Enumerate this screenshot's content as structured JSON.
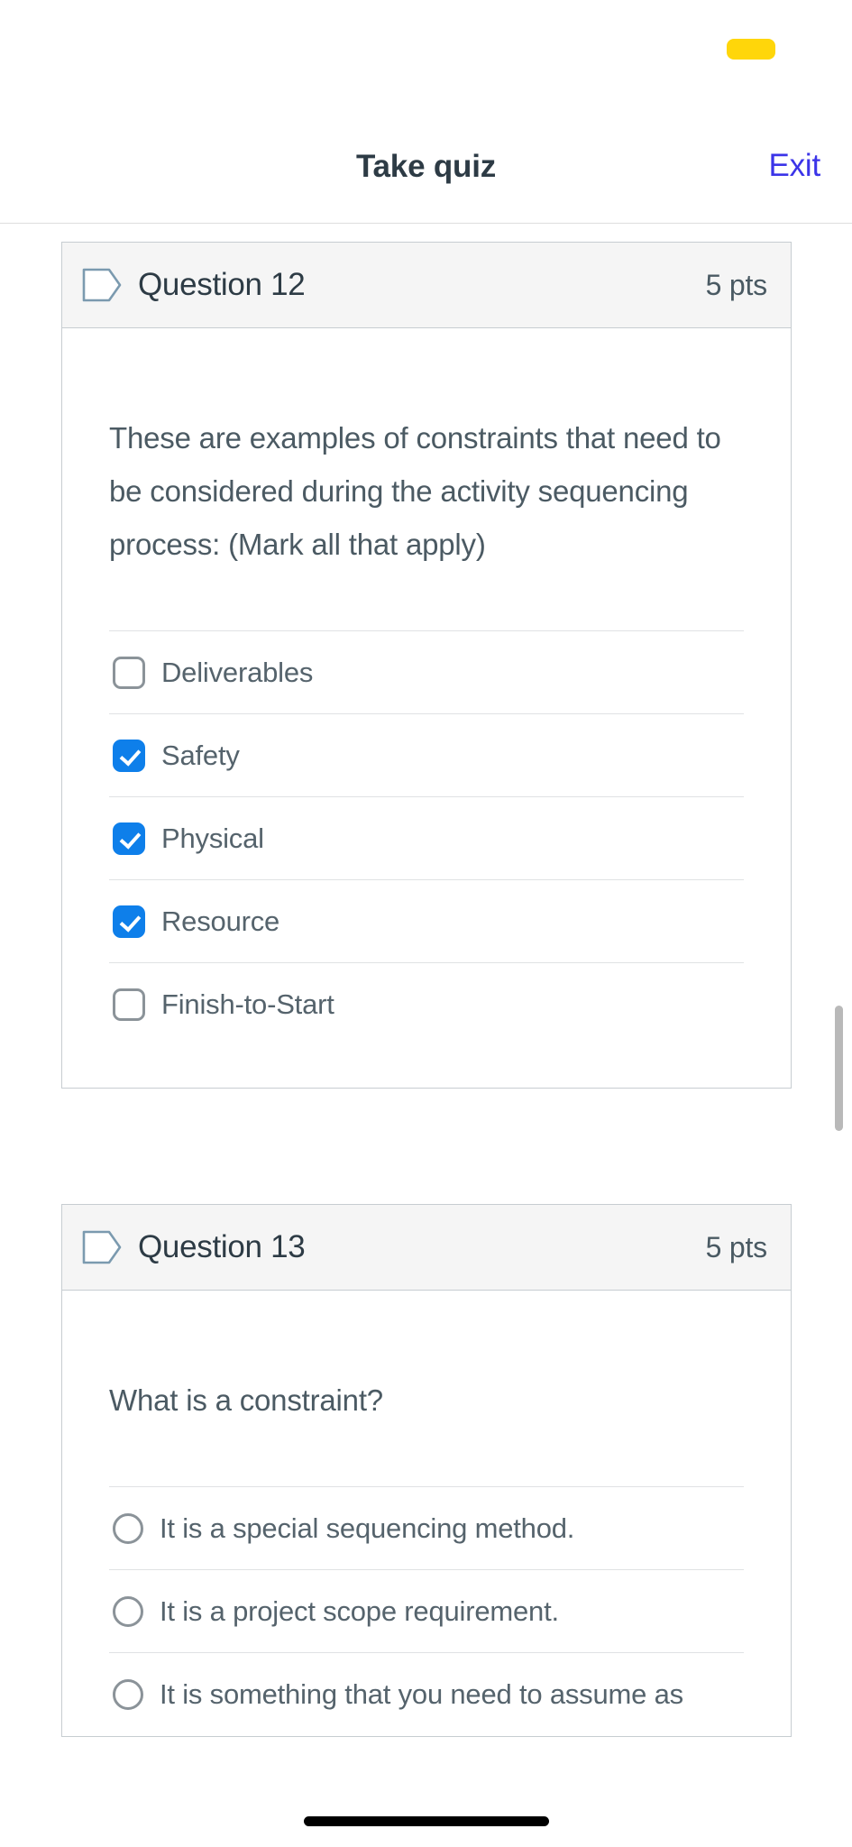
{
  "status_bar": {
    "recording_indicator": "recording-pill"
  },
  "nav": {
    "title": "Take quiz",
    "exit_label": "Exit"
  },
  "questions": [
    {
      "id": "question-12",
      "name": "Question 12",
      "points": "5 pts",
      "flag_icon": "flag-tag-icon",
      "prompt": "These are examples of constraints that need to be considered during the activity sequencing process: (Mark all that apply)",
      "input_type": "checkbox",
      "options": [
        {
          "label": "Deliverables",
          "checked": false
        },
        {
          "label": "Safety",
          "checked": true
        },
        {
          "label": "Physical",
          "checked": true
        },
        {
          "label": "Resource",
          "checked": true
        },
        {
          "label": "Finish-to-Start",
          "checked": false
        }
      ]
    },
    {
      "id": "question-13",
      "name": "Question 13",
      "points": "5 pts",
      "flag_icon": "flag-tag-icon",
      "prompt": "What is a constraint?",
      "input_type": "radio",
      "options": [
        {
          "label": "It is a special sequencing method.",
          "checked": false
        },
        {
          "label": "It is a project scope requirement.",
          "checked": false
        },
        {
          "label": "It is something that you need to assume as",
          "checked": false
        }
      ]
    }
  ],
  "colors": {
    "accent_blue": "#0E7FEA",
    "link_blue": "#3B34E8",
    "title_dark": "#2D3B45",
    "body_gray": "#4b5a63",
    "header_bg": "#f5f5f5",
    "card_border": "#c7cdd1",
    "recording_yellow": "#FFD60A",
    "flag_stroke": "#7B9AAF"
  }
}
